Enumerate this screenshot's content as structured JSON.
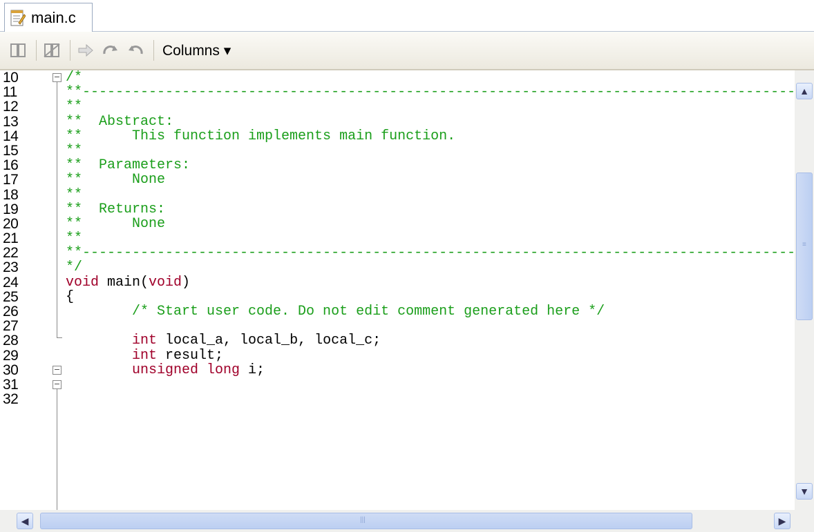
{
  "tab": {
    "label": "main.c"
  },
  "toolbar": {
    "columns_label": "Columns ▾"
  },
  "lines": [
    {
      "n": "10",
      "parts": [
        [
          "cm",
          "/*"
        ]
      ]
    },
    {
      "n": "11",
      "parts": [
        [
          "cm",
          "**-----------------------------------------------------------------------------------------------"
        ]
      ]
    },
    {
      "n": "12",
      "parts": [
        [
          "cm",
          "**"
        ]
      ]
    },
    {
      "n": "13",
      "parts": [
        [
          "cm",
          "**  Abstract:"
        ]
      ]
    },
    {
      "n": "14",
      "parts": [
        [
          "cm",
          "**      This function implements main function."
        ]
      ]
    },
    {
      "n": "15",
      "parts": [
        [
          "cm",
          "**"
        ]
      ]
    },
    {
      "n": "16",
      "parts": [
        [
          "cm",
          "**  Parameters:"
        ]
      ]
    },
    {
      "n": "17",
      "parts": [
        [
          "cm",
          "**      None"
        ]
      ]
    },
    {
      "n": "18",
      "parts": [
        [
          "cm",
          "**"
        ]
      ]
    },
    {
      "n": "19",
      "parts": [
        [
          "cm",
          "**  Returns:"
        ]
      ]
    },
    {
      "n": "20",
      "parts": [
        [
          "cm",
          "**      None"
        ]
      ]
    },
    {
      "n": "21",
      "parts": [
        [
          "cm",
          "**"
        ]
      ]
    },
    {
      "n": "22",
      "parts": [
        [
          "cm",
          "**-----------------------------------------------------------------------------------------------"
        ]
      ]
    },
    {
      "n": "23",
      "parts": [
        [
          "cm",
          "*/"
        ]
      ]
    },
    {
      "n": "24",
      "parts": [
        [
          "kw",
          "void"
        ],
        [
          "tx",
          " main("
        ],
        [
          "kw",
          "void"
        ],
        [
          "tx",
          ")"
        ]
      ]
    },
    {
      "n": "25",
      "parts": [
        [
          "tx",
          "{"
        ]
      ]
    },
    {
      "n": "26",
      "parts": [
        [
          "cm",
          "        /* Start user code. Do not edit comment generated here */"
        ]
      ]
    },
    {
      "n": "27",
      "parts": [
        [
          "tx",
          ""
        ]
      ]
    },
    {
      "n": "28",
      "parts": [
        [
          "tx",
          "        "
        ],
        [
          "kw",
          "int"
        ],
        [
          "tx",
          " local_a, local_b, local_c;"
        ]
      ]
    },
    {
      "n": "29",
      "parts": [
        [
          "tx",
          "        "
        ],
        [
          "kw",
          "int"
        ],
        [
          "tx",
          " result;"
        ]
      ]
    },
    {
      "n": "30",
      "parts": [
        [
          "tx",
          "        "
        ],
        [
          "kw",
          "unsigned long"
        ],
        [
          "tx",
          " i;"
        ]
      ]
    },
    {
      "n": "31",
      "parts": [
        [
          "tx",
          ""
        ]
      ]
    },
    {
      "n": "32",
      "parts": [
        [
          "tx",
          ""
        ]
      ]
    }
  ]
}
